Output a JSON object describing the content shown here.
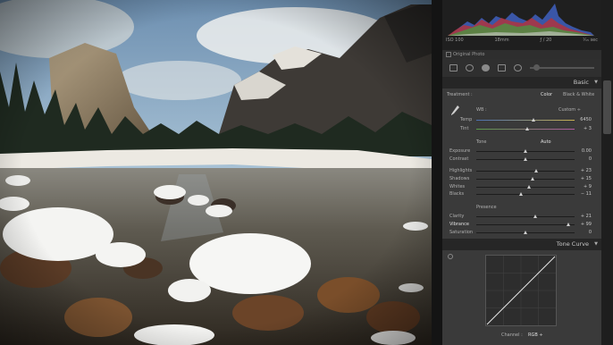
{
  "histogram": {
    "iso": "ISO 100",
    "focal": "18mm",
    "aperture": "ƒ / 20",
    "shutter": "⅟₁₅ sec"
  },
  "original_photo": "Original Photo",
  "basic": {
    "header": "Basic",
    "treatment_label": "Treatment :",
    "color_option": "Color",
    "bw_option": "Black & White",
    "wb_label": "WB :",
    "wb_value": "Custom ÷",
    "temp_label": "Temp",
    "temp_value": "6450",
    "temp_level": 0.58,
    "tint_label": "Tint",
    "tint_value": "+ 3",
    "tint_level": 0.52,
    "tone_label": "Tone",
    "auto_label": "Auto",
    "exposure_label": "Exposure",
    "exposure_value": "0.00",
    "exposure_level": 0.5,
    "contrast_label": "Contrast",
    "contrast_value": "0",
    "contrast_level": 0.5,
    "highlights_label": "Highlights",
    "highlights_value": "+ 23",
    "highlights_level": 0.61,
    "shadows_label": "Shadows",
    "shadows_value": "+ 15",
    "shadows_level": 0.57,
    "whites_label": "Whites",
    "whites_value": "+ 9",
    "whites_level": 0.54,
    "blacks_label": "Blacks",
    "blacks_value": "− 11",
    "blacks_level": 0.45,
    "presence_label": "Presence",
    "clarity_label": "Clarity",
    "clarity_value": "+ 21",
    "clarity_level": 0.6,
    "vibrance_label": "Vibrance",
    "vibrance_value": "+ 99",
    "vibrance_level": 0.94,
    "saturation_label": "Saturation",
    "saturation_value": "0",
    "saturation_level": 0.5
  },
  "tone_curve": {
    "header": "Tone Curve",
    "channel_label": "Channel :",
    "channel_value": "RGB ÷"
  },
  "colors": {
    "panel_bg": "#3a3a3a",
    "header_bg": "#262626"
  }
}
